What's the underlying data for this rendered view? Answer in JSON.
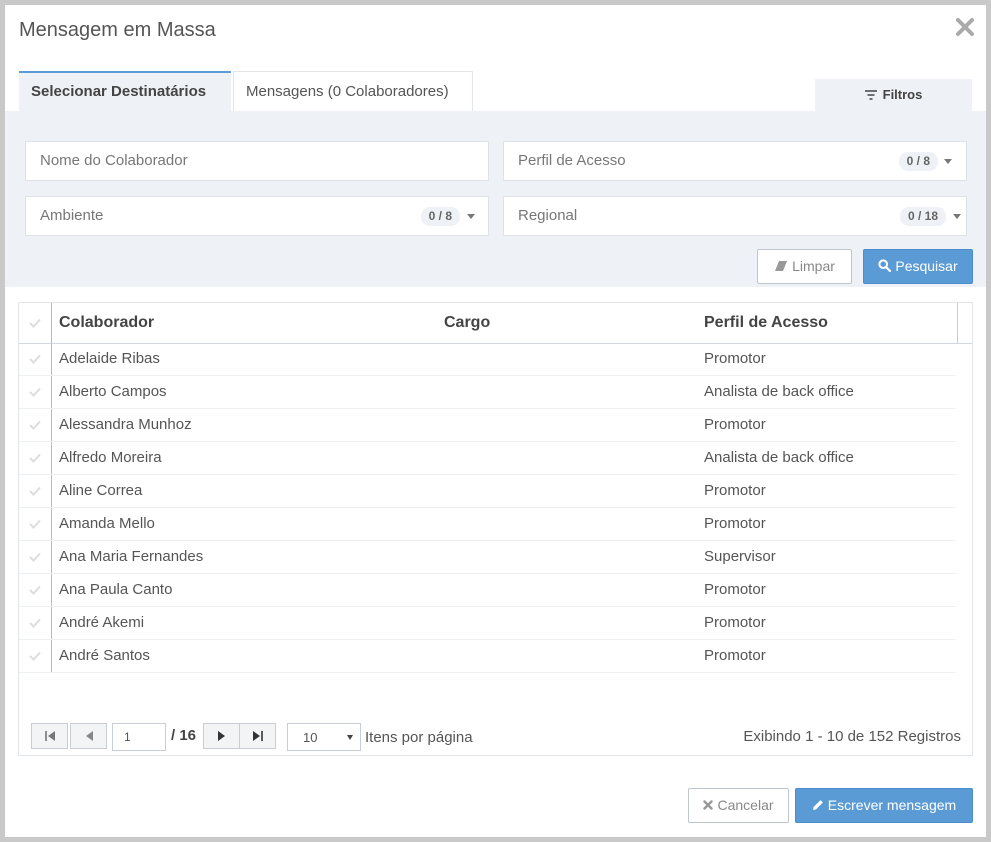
{
  "dialog": {
    "title": "Mensagem em Massa",
    "close_icon": "close-icon"
  },
  "tabs": [
    {
      "label": "Selecionar Destinatários",
      "active": true
    },
    {
      "label": "Mensagens (0 Colaboradores)",
      "active": false
    }
  ],
  "filters_tab": {
    "label": "Filtros",
    "icon": "filter-icon"
  },
  "filters": {
    "nome_placeholder": "Nome do Colaborador",
    "perfil": {
      "label": "Perfil de Acesso",
      "count": "0 / 8"
    },
    "ambiente": {
      "label": "Ambiente",
      "count": "0 / 8"
    },
    "regional": {
      "label": "Regional",
      "count": "0 / 18"
    }
  },
  "buttons": {
    "limpar": "Limpar",
    "pesquisar": "Pesquisar",
    "cancelar": "Cancelar",
    "escrever": "Escrever mensagem"
  },
  "grid": {
    "columns": [
      "Colaborador",
      "Cargo",
      "Perfil de Acesso"
    ],
    "rows": [
      {
        "colaborador": "Adelaide Ribas",
        "cargo": "",
        "perfil": "Promotor"
      },
      {
        "colaborador": "Alberto Campos",
        "cargo": "",
        "perfil": "Analista de back office"
      },
      {
        "colaborador": "Alessandra Munhoz",
        "cargo": "",
        "perfil": "Promotor"
      },
      {
        "colaborador": "Alfredo Moreira",
        "cargo": "",
        "perfil": "Analista de back office"
      },
      {
        "colaborador": "Aline Correa",
        "cargo": "",
        "perfil": "Promotor"
      },
      {
        "colaborador": "Amanda Mello",
        "cargo": "",
        "perfil": "Promotor"
      },
      {
        "colaborador": "Ana Maria Fernandes",
        "cargo": "",
        "perfil": "Supervisor"
      },
      {
        "colaborador": "Ana Paula Canto",
        "cargo": "",
        "perfil": "Promotor"
      },
      {
        "colaborador": "André Akemi",
        "cargo": "",
        "perfil": "Promotor"
      },
      {
        "colaborador": "André Santos",
        "cargo": "",
        "perfil": "Promotor"
      }
    ]
  },
  "pager": {
    "page": "1",
    "total_pages": "/ 16",
    "page_size": "10",
    "items_label": "Itens por página",
    "info": "Exibindo 1 - 10 de 152 Registros"
  },
  "colors": {
    "primary": "#5b9bd5",
    "panel": "#eef1f5"
  }
}
